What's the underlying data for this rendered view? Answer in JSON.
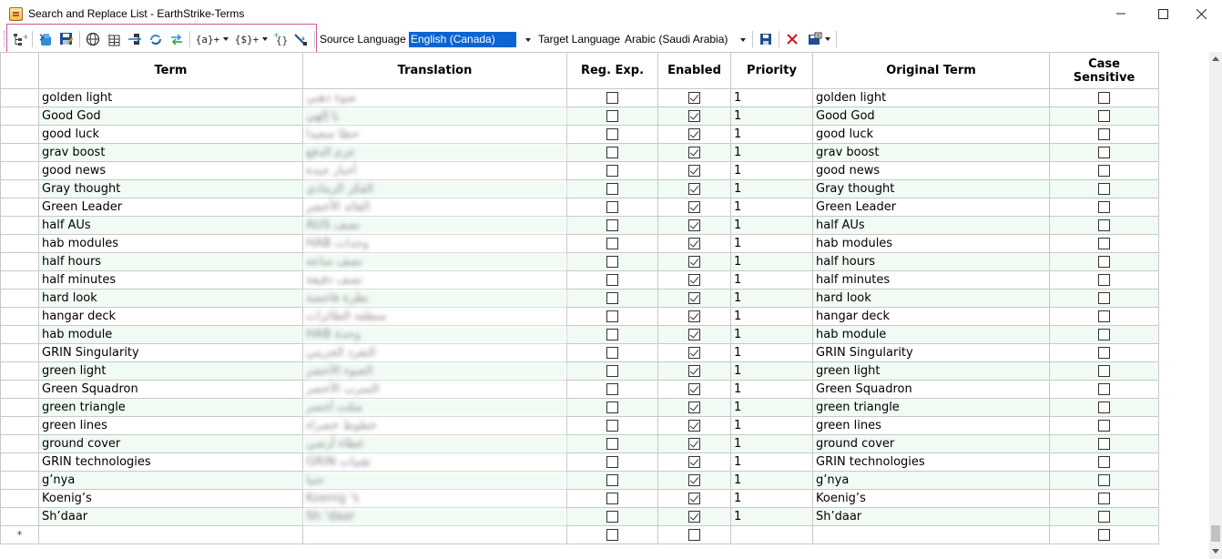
{
  "window": {
    "title": "Search and Replace List - EarthStrike-Terms"
  },
  "toolbar": {
    "buttons": [
      {
        "name": "add-tree-icon"
      },
      {
        "name": "import-icon"
      },
      {
        "name": "save-list-icon"
      },
      {
        "name": "globe-icon"
      },
      {
        "name": "add-grid-icon"
      },
      {
        "name": "move-icon"
      },
      {
        "name": "refresh-icon"
      },
      {
        "name": "swap-icon"
      }
    ],
    "pattern_buttons": [
      "{a}+",
      "{$}+"
    ],
    "source_language_label": "Source Language",
    "source_language_value": "English (Canada)",
    "target_language_label": "Target Language",
    "target_language_value": "Arabic (Saudi Arabia)",
    "highlight_color": "#d2559c"
  },
  "grid": {
    "headers": {
      "term": "Term",
      "translation": "Translation",
      "regexp": "Reg. Exp.",
      "enabled": "Enabled",
      "priority": "Priority",
      "original": "Original Term",
      "case_line1": "Case",
      "case_line2": "Sensitive"
    },
    "new_row_marker": "*",
    "rows": [
      {
        "term": "golden light",
        "translation": "ضوء ذهبي",
        "regexp": false,
        "enabled": true,
        "priority": "1",
        "original": "golden light",
        "case": false
      },
      {
        "term": "Good God",
        "translation": "يا إلهي",
        "regexp": false,
        "enabled": true,
        "priority": "1",
        "original": "Good God",
        "case": false
      },
      {
        "term": "good luck",
        "translation": "حظا سعيدا",
        "regexp": false,
        "enabled": true,
        "priority": "1",
        "original": "good luck",
        "case": false
      },
      {
        "term": "grav boost",
        "translation": "عزم الدفع",
        "regexp": false,
        "enabled": true,
        "priority": "1",
        "original": "grav boost",
        "case": false
      },
      {
        "term": "good news",
        "translation": "أخبار جيدة",
        "regexp": false,
        "enabled": true,
        "priority": "1",
        "original": "good news",
        "case": false
      },
      {
        "term": "Gray thought",
        "translation": "الفكر الرمادي",
        "regexp": false,
        "enabled": true,
        "priority": "1",
        "original": "Gray thought",
        "case": false
      },
      {
        "term": "Green Leader",
        "translation": "القائد الأخضر",
        "regexp": false,
        "enabled": true,
        "priority": "1",
        "original": "Green Leader",
        "case": false
      },
      {
        "term": "half AUs",
        "translation": "نصف AUS",
        "regexp": false,
        "enabled": true,
        "priority": "1",
        "original": "half AUs",
        "case": false
      },
      {
        "term": "hab modules",
        "translation": "وحدات HAB",
        "regexp": false,
        "enabled": true,
        "priority": "1",
        "original": "hab modules",
        "case": false
      },
      {
        "term": "half hours",
        "translation": "نصف ساعة",
        "regexp": false,
        "enabled": true,
        "priority": "1",
        "original": "half hours",
        "case": false
      },
      {
        "term": "half minutes",
        "translation": "نصف دقيقة",
        "regexp": false,
        "enabled": true,
        "priority": "1",
        "original": "half minutes",
        "case": false
      },
      {
        "term": "hard look",
        "translation": "نظرة فاحصة",
        "regexp": false,
        "enabled": true,
        "priority": "1",
        "original": "hard look",
        "case": false
      },
      {
        "term": "hangar deck",
        "translation": "منطقة الطائرات",
        "regexp": false,
        "enabled": true,
        "priority": "1",
        "original": "hangar deck",
        "case": false
      },
      {
        "term": "hab module",
        "translation": "وحدة HAB",
        "regexp": false,
        "enabled": true,
        "priority": "1",
        "original": "hab module",
        "case": false
      },
      {
        "term": "GRIN Singularity",
        "translation": "التفرد الجريني",
        "regexp": false,
        "enabled": true,
        "priority": "1",
        "original": "GRIN Singularity",
        "case": false
      },
      {
        "term": "green light",
        "translation": "الضوء الأخضر",
        "regexp": false,
        "enabled": true,
        "priority": "1",
        "original": "green light",
        "case": false
      },
      {
        "term": "Green Squadron",
        "translation": "السرب الأخضر",
        "regexp": false,
        "enabled": true,
        "priority": "1",
        "original": "Green Squadron",
        "case": false
      },
      {
        "term": "green triangle",
        "translation": "مثلث أخضر",
        "regexp": false,
        "enabled": true,
        "priority": "1",
        "original": "green triangle",
        "case": false
      },
      {
        "term": "green lines",
        "translation": "خطوط خضراء",
        "regexp": false,
        "enabled": true,
        "priority": "1",
        "original": "green lines",
        "case": false
      },
      {
        "term": "ground cover",
        "translation": "غطاء أرضي",
        "regexp": false,
        "enabled": true,
        "priority": "1",
        "original": "ground cover",
        "case": false
      },
      {
        "term": "GRIN technologies",
        "translation": "تقنيات GRIN",
        "regexp": false,
        "enabled": true,
        "priority": "1",
        "original": "GRIN technologies",
        "case": false
      },
      {
        "term": "g’nya",
        "translation": "جنيا",
        "regexp": false,
        "enabled": true,
        "priority": "1",
        "original": "g’nya",
        "case": false
      },
      {
        "term": "Koenig’s",
        "translation": "Koenig 's",
        "regexp": false,
        "enabled": true,
        "priority": "1",
        "original": "Koenig’s",
        "case": false
      },
      {
        "term": "Sh’daar",
        "translation": "Sh 'daar",
        "regexp": false,
        "enabled": true,
        "priority": "1",
        "original": "Sh’daar",
        "case": false
      }
    ]
  }
}
